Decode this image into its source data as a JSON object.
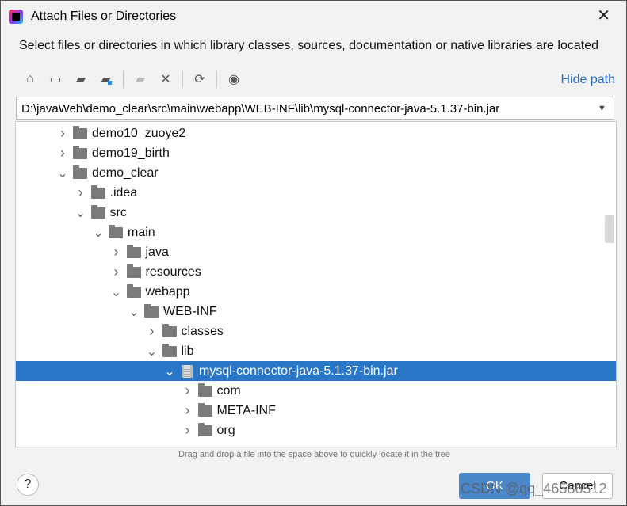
{
  "window": {
    "title": "Attach Files or Directories",
    "close": "✕"
  },
  "description": "Select files or directories in which library classes, sources, documentation or native libraries are located",
  "toolbar": {
    "icons": [
      "home-icon",
      "desktop-icon",
      "project-folder-icon",
      "module-folder-icon",
      "new-folder-icon",
      "delete-icon",
      "refresh-icon",
      "show-hidden-icon"
    ],
    "hide_path": "Hide path"
  },
  "path": {
    "value": "D:\\javaWeb\\demo_clear\\src\\main\\webapp\\WEB-INF\\lib\\mysql-connector-java-5.1.37-bin.jar"
  },
  "tree": [
    {
      "label": "demo10_zuoye2",
      "depth": 0,
      "expanded": false,
      "type": "folder"
    },
    {
      "label": "demo19_birth",
      "depth": 0,
      "expanded": false,
      "type": "folder"
    },
    {
      "label": "demo_clear",
      "depth": 0,
      "expanded": true,
      "type": "folder"
    },
    {
      "label": ".idea",
      "depth": 1,
      "expanded": false,
      "type": "folder"
    },
    {
      "label": "src",
      "depth": 1,
      "expanded": true,
      "type": "folder"
    },
    {
      "label": "main",
      "depth": 2,
      "expanded": true,
      "type": "folder"
    },
    {
      "label": "java",
      "depth": 3,
      "expanded": false,
      "type": "folder"
    },
    {
      "label": "resources",
      "depth": 3,
      "expanded": false,
      "type": "folder"
    },
    {
      "label": "webapp",
      "depth": 3,
      "expanded": true,
      "type": "folder"
    },
    {
      "label": "WEB-INF",
      "depth": 4,
      "expanded": true,
      "type": "folder"
    },
    {
      "label": "classes",
      "depth": 5,
      "expanded": false,
      "type": "folder"
    },
    {
      "label": "lib",
      "depth": 5,
      "expanded": true,
      "type": "folder"
    },
    {
      "label": "mysql-connector-java-5.1.37-bin.jar",
      "depth": 6,
      "expanded": true,
      "type": "jar",
      "selected": true
    },
    {
      "label": "com",
      "depth": 7,
      "expanded": false,
      "type": "folder"
    },
    {
      "label": "META-INF",
      "depth": 7,
      "expanded": false,
      "type": "folder"
    },
    {
      "label": "org",
      "depth": 7,
      "expanded": false,
      "type": "folder"
    }
  ],
  "hint": "Drag and drop a file into the space above to quickly locate it in the tree",
  "buttons": {
    "help": "?",
    "ok": "OK",
    "cancel": "Cancel"
  },
  "watermark": "CSDN @qq_46586512",
  "colors": {
    "selection": "#2a76c6",
    "link": "#2f6fc6",
    "ok": "#4a86c8"
  }
}
